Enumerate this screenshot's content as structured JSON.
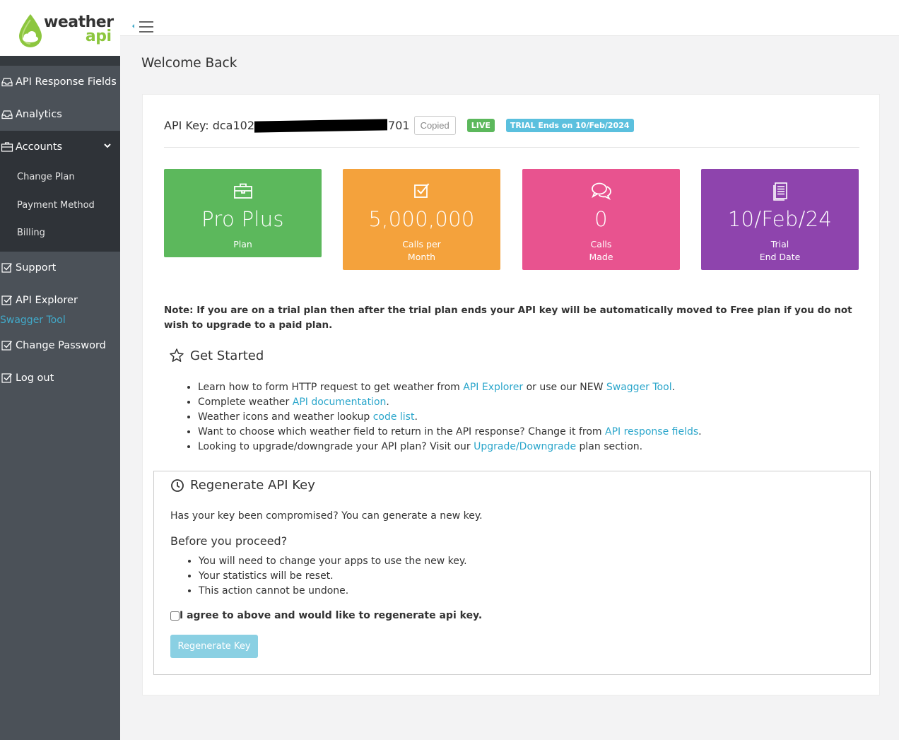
{
  "logo": {
    "line1": "weather",
    "line2": "api"
  },
  "sidebar": {
    "items": [
      {
        "label": "API Response Fields",
        "icon": "inbox-icon"
      },
      {
        "label": "Analytics",
        "icon": "inbox-icon"
      },
      {
        "label": "Accounts",
        "icon": "briefcase-icon"
      }
    ],
    "submenu": [
      "Change Plan",
      "Payment Method",
      "Billing"
    ],
    "items2": [
      {
        "label": "Support",
        "icon": "checkbox-icon"
      },
      {
        "label": "API Explorer",
        "icon": "checkbox-icon"
      }
    ],
    "swagger": "Swagger Tool",
    "items3": [
      {
        "label": "Change Password",
        "icon": "checkbox-icon"
      },
      {
        "label": "Log out",
        "icon": "checkbox-icon"
      }
    ]
  },
  "page": {
    "title": "Welcome Back"
  },
  "apikey": {
    "label": "API Key: dca102",
    "suffix": "701",
    "copied": "Copied",
    "live": "LIVE",
    "trial": "TRIAL Ends on 10/Feb/2024"
  },
  "tiles": [
    {
      "value": "Pro Plus",
      "label1": "Plan",
      "label2": "",
      "icon": "briefcase-icon",
      "color": "#5cb85c"
    },
    {
      "value": "5,000,000",
      "label1": "Calls per",
      "label2": "Month",
      "icon": "checkbox-icon",
      "color": "#f4a23c"
    },
    {
      "value": "0",
      "label1": "Calls",
      "label2": "Made",
      "icon": "chat-bubbles-icon",
      "color": "#e8538f"
    },
    {
      "value": "10/Feb/24",
      "label1": "Trial",
      "label2": "End Date",
      "icon": "document-icon",
      "color": "#8e44ad"
    }
  ],
  "note": "Note: If you are on a trial plan then after the trial plan ends your API key will be automatically moved to Free plan if you do not wish to upgrade to a paid plan.",
  "get_started": {
    "title": "Get Started",
    "items": [
      {
        "pre": "Learn how to form HTTP request to get weather from ",
        "link": "API Explorer",
        "mid": " or use our NEW ",
        "link2": "Swagger Tool",
        "post": "."
      },
      {
        "pre": "Complete weather ",
        "link": "API documentation",
        "post": "."
      },
      {
        "pre": "Weather icons and weather lookup ",
        "link": "code list",
        "post": "."
      },
      {
        "pre": "Want to choose which weather field to return in the API response? Change it from ",
        "link": "API response fields",
        "post": "."
      },
      {
        "pre": "Looking to upgrade/downgrade your API plan? Visit our ",
        "link": "Upgrade/Downgrade",
        "post": " plan section."
      }
    ]
  },
  "regen": {
    "title": "Regenerate API Key",
    "question": "Has your key been compromised? You can generate a new key.",
    "before": "Before you proceed?",
    "items": [
      "You will need to change your apps to use the new key.",
      "Your statistics will be reset.",
      "This action cannot be undone."
    ],
    "agree": "I agree to above and would like to regenerate api key.",
    "button": "Regenerate Key"
  },
  "colors": {
    "sidebar": "#4b5158",
    "link": "#2ba6cb",
    "accent_green": "#8cc63e"
  }
}
